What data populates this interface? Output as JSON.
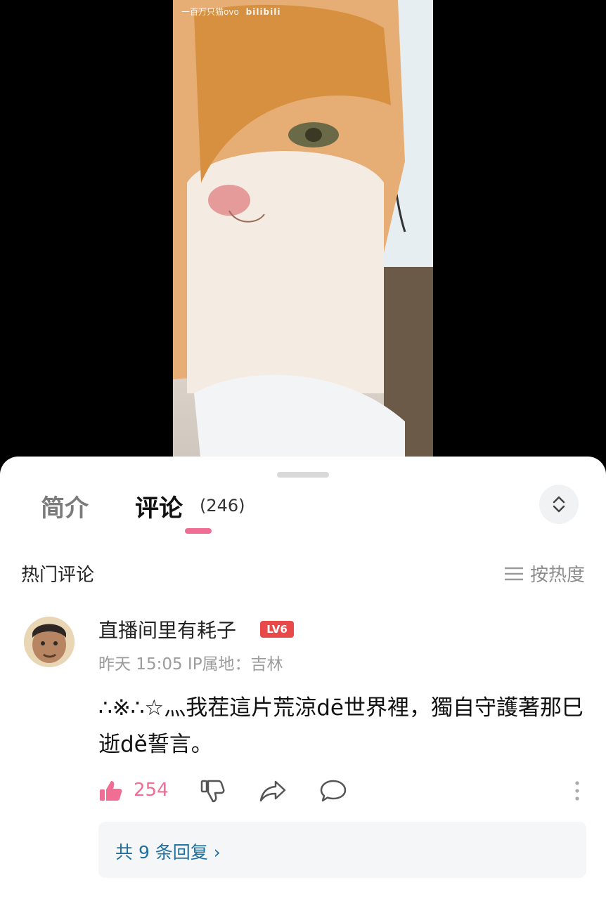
{
  "video": {
    "watermark_text": "一百万只猫ovo",
    "watermark_logo": "bilibili"
  },
  "tabs": {
    "intro_label": "简介",
    "comments_label": "评论",
    "comments_count": "(246)",
    "active_tab": "comments"
  },
  "expand_icon": "chevron-up-down-icon",
  "hot_comments": {
    "title": "热门评论",
    "sort_label": "按热度",
    "sort_icon": "sort-lines-icon"
  },
  "comment": {
    "avatar_icon": "user-avatar",
    "username": "直播间里有耗子",
    "level_badge": "LV6",
    "meta": "昨天 15:05 IP属地：吉林",
    "content": "∴※∴☆灬我茬這片荒涼dē世界裡，獨自守護著那巳逝dě誓言。",
    "like_count": "254",
    "replies_label": "共 9 条回复 ›"
  },
  "colors": {
    "accent_pink": "#f06e94",
    "level_red": "#e84a4a",
    "reply_link_blue": "#1f6f9f"
  }
}
